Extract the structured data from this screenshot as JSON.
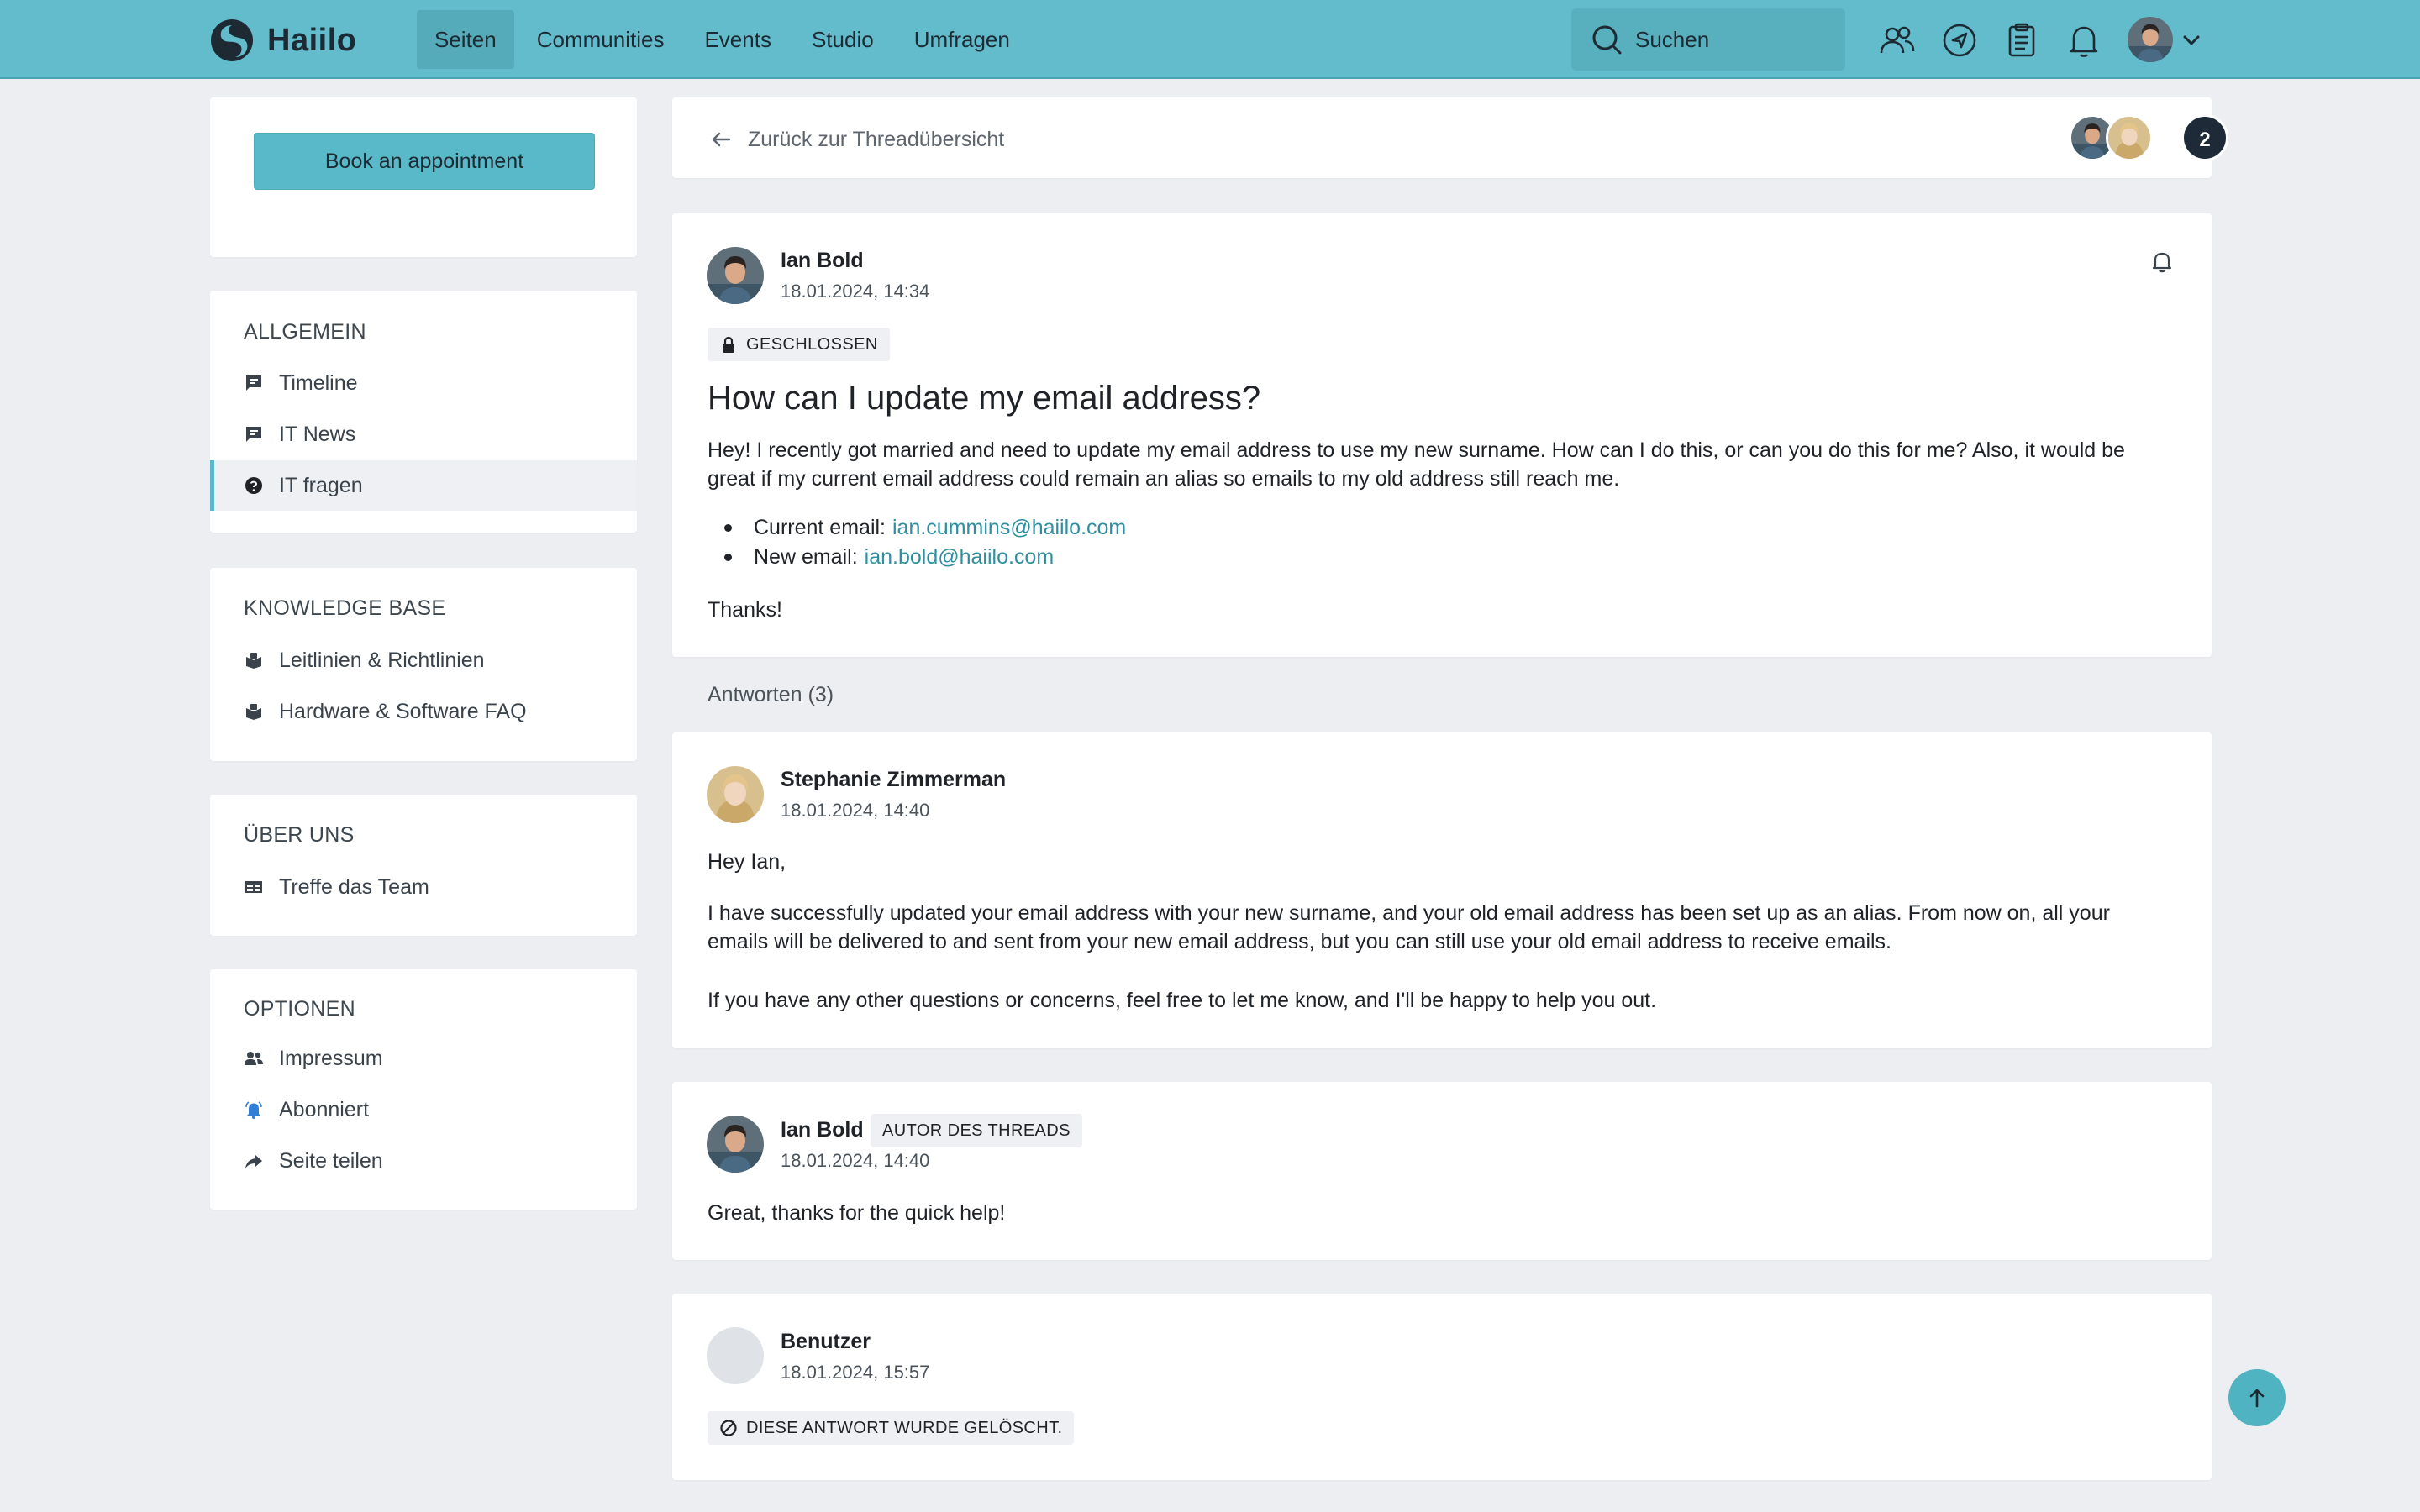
{
  "app": {
    "name": "Haiilo"
  },
  "nav": {
    "items": [
      {
        "label": "Seiten",
        "active": true
      },
      {
        "label": "Communities",
        "active": false
      },
      {
        "label": "Events",
        "active": false
      },
      {
        "label": "Studio",
        "active": false
      },
      {
        "label": "Umfragen",
        "active": false
      }
    ]
  },
  "search": {
    "placeholder": "Suchen"
  },
  "colors": {
    "topbar": "#62bccb",
    "accent": "#5ab9c8",
    "link": "#2e8fa0",
    "background": "#eceef1"
  },
  "sidebar": {
    "book_button": "Book an appointment",
    "sections": [
      {
        "title": "ALLGEMEIN",
        "items": [
          {
            "label": "Timeline",
            "icon": "comment-icon"
          },
          {
            "label": "IT News",
            "icon": "comment-icon"
          },
          {
            "label": "IT fragen",
            "icon": "question-icon",
            "active": true
          }
        ]
      },
      {
        "title": "KNOWLEDGE BASE",
        "items": [
          {
            "label": "Leitlinien & Richtlinien",
            "icon": "book-icon"
          },
          {
            "label": "Hardware & Software FAQ",
            "icon": "book-icon"
          }
        ]
      },
      {
        "title": "ÜBER UNS",
        "items": [
          {
            "label": "Treffe das Team",
            "icon": "table-icon"
          }
        ]
      },
      {
        "title": "OPTIONEN",
        "items": [
          {
            "label": "Impressum",
            "icon": "people-icon"
          },
          {
            "label": "Abonniert",
            "icon": "bell-ring-icon"
          },
          {
            "label": "Seite teilen",
            "icon": "share-icon"
          }
        ]
      }
    ]
  },
  "thread": {
    "back_label": "Zurück zur Threadübersicht",
    "participants_count": "2",
    "author": "Ian Bold",
    "date": "18.01.2024, 14:34",
    "status": "GESCHLOSSEN",
    "title": "How can I update my email address?",
    "body": "Hey! I recently got married and need to update my email address to use my new surname. How can I do this, or can you do this for me? Also, it would be great if my current email address could remain an alias so emails to my old address still reach me.",
    "bullets": [
      {
        "label": "Current email:",
        "link": "ian.cummins@haiilo.com"
      },
      {
        "label": "New email:",
        "link": "ian.bold@haiilo.com"
      }
    ],
    "closing": "Thanks!"
  },
  "replies": {
    "label": "Antworten (3)",
    "items": [
      {
        "author": "Stephanie Zimmerman",
        "date": "18.01.2024, 14:40",
        "paragraphs": [
          "Hey Ian,",
          "I have successfully updated your email address with your new surname, and your old email address has been set up as an alias. From now on, all your emails will be delivered to and sent from your new email address, but you can still use your old email address to receive emails.",
          "If you have any other questions or concerns, feel free to let me know, and I'll be happy to help you out."
        ]
      },
      {
        "author": "Ian Bold",
        "badge": "AUTOR DES THREADS",
        "date": "18.01.2024, 14:40",
        "paragraphs": [
          "Great, thanks for the quick help!"
        ]
      },
      {
        "author": "Benutzer",
        "date": "18.01.2024, 15:57",
        "deleted_notice": "DIESE ANTWORT WURDE GELÖSCHT."
      }
    ]
  }
}
